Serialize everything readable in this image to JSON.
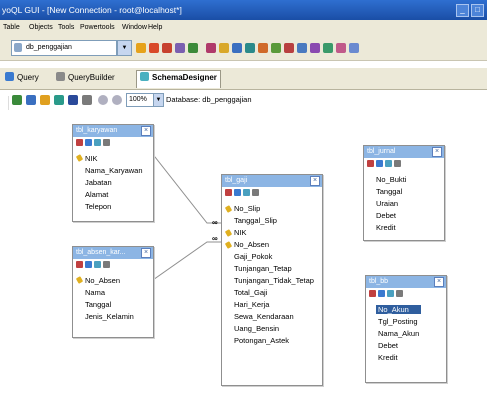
{
  "window": {
    "title": "yoQL GUI - [New Connection - root@localhost*]"
  },
  "menu": [
    "Table",
    "Objects",
    "Tools",
    "Powertools",
    "Window",
    "Help"
  ],
  "database_selector": {
    "value": "db_penggajian"
  },
  "tabs": {
    "query": "Query",
    "query_builder": "QueryBuilder",
    "schema_designer": "SchemaDesigner"
  },
  "designer_toolbar": {
    "zoom": "100%",
    "database_label": "Database: db_penggajian"
  },
  "tables": {
    "tbl_karyawan": {
      "name": "tbl_karyawan",
      "fields": [
        "NIK",
        "Nama_Karyawan",
        "Jabatan",
        "Alamat",
        "Telepon"
      ]
    },
    "tbl_absen": {
      "name": "tbl_absen_kar...",
      "fields": [
        "No_Absen",
        "Nama",
        "Tanggal",
        "Jenis_Kelamin"
      ]
    },
    "tbl_gaji": {
      "name": "tbl_gaji",
      "fields": [
        "No_Slip",
        "Tanggal_Slip",
        "NIK",
        "No_Absen",
        "Gaji_Pokok",
        "Tunjangan_Tetap",
        "Tunjangan_Tidak_Tetap",
        "Total_Gaji",
        "Hari_Kerja",
        "Sewa_Kendaraan",
        "Uang_Bensin",
        "Potongan_Astek"
      ]
    },
    "tbl_jurnal": {
      "name": "tbl_jurnal",
      "fields": [
        "No_Bukti",
        "Tanggal",
        "Uraian",
        "Debet",
        "Kredit"
      ]
    },
    "tbl_bb": {
      "name": "tbl_bb",
      "fields": [
        "No_Akun",
        "Tgl_Posting",
        "Nama_Akun",
        "Debet",
        "Kredit"
      ]
    }
  },
  "relations": {
    "one": "1",
    "many": "∞"
  },
  "colors": {
    "titlebar": "#1a4ea6",
    "table_header": "#8cb5e4",
    "selected_row": "#2f5e9e"
  }
}
